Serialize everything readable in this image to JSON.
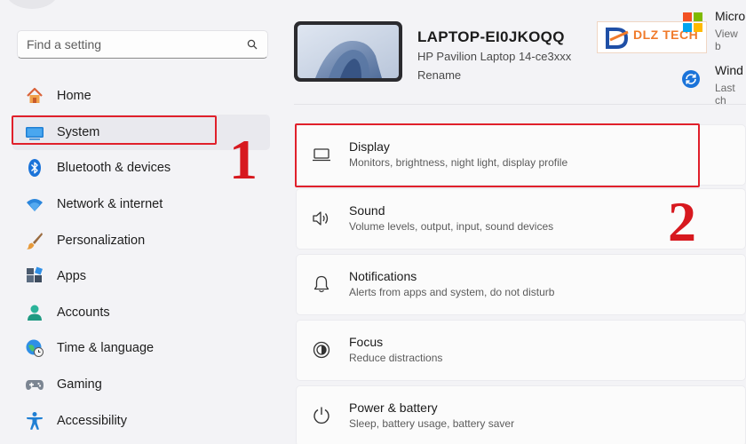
{
  "search": {
    "placeholder": "Find a setting",
    "icon": "search-icon"
  },
  "sidebar": {
    "items": [
      {
        "label": "Home",
        "icon": "home-icon"
      },
      {
        "label": "System",
        "icon": "system-icon",
        "selected": true
      },
      {
        "label": "Bluetooth & devices",
        "icon": "bluetooth-icon"
      },
      {
        "label": "Network & internet",
        "icon": "wifi-icon"
      },
      {
        "label": "Personalization",
        "icon": "brush-icon"
      },
      {
        "label": "Apps",
        "icon": "apps-icon"
      },
      {
        "label": "Accounts",
        "icon": "accounts-icon"
      },
      {
        "label": "Time & language",
        "icon": "globe-clock-icon"
      },
      {
        "label": "Gaming",
        "icon": "gamepad-icon"
      },
      {
        "label": "Accessibility",
        "icon": "accessibility-icon"
      }
    ]
  },
  "device": {
    "name": "LAPTOP-EI0JKOQQ",
    "model": "HP Pavilion Laptop 14-ce3xxx",
    "rename": "Rename"
  },
  "right_panel": {
    "ms_title": "Micro",
    "ms_sub": "View b",
    "update_title": "Wind",
    "update_sub": "Last ch"
  },
  "watermark": {
    "text": "DLZ TECH"
  },
  "cards": [
    {
      "title": "Display",
      "subtitle": "Monitors, brightness, night light, display profile",
      "icon": "monitor-icon"
    },
    {
      "title": "Sound",
      "subtitle": "Volume levels, output, input, sound devices",
      "icon": "speaker-icon"
    },
    {
      "title": "Notifications",
      "subtitle": "Alerts from apps and system, do not disturb",
      "icon": "bell-icon"
    },
    {
      "title": "Focus",
      "subtitle": "Reduce distractions",
      "icon": "focus-icon"
    },
    {
      "title": "Power & battery",
      "subtitle": "Sleep, battery usage, battery saver",
      "icon": "power-icon"
    }
  ],
  "annotations": {
    "step1": "1",
    "step2": "2"
  },
  "colors": {
    "highlight": "#e0202b",
    "accent": "#0067c0"
  }
}
